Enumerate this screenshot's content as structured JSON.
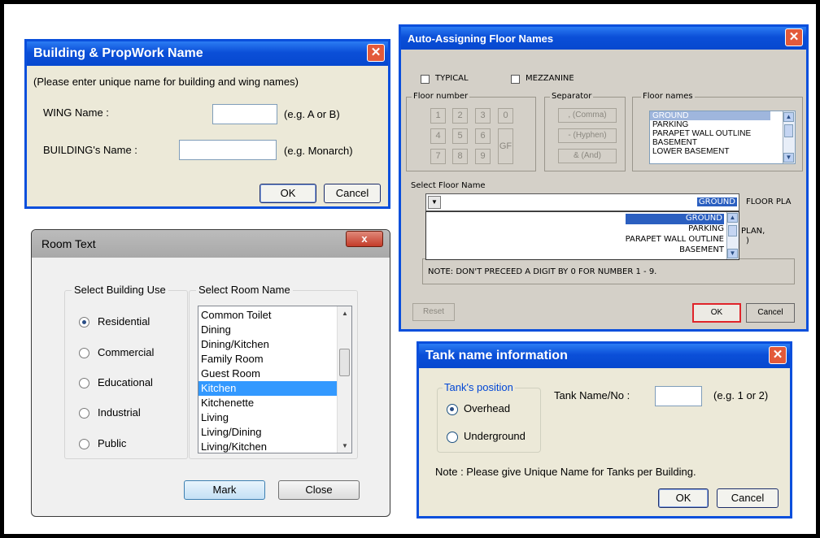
{
  "building_dialog": {
    "title": "Building & PropWork Name",
    "instruction": "(Please enter unique name for building and wing names)",
    "wing_label": "WING Name :",
    "wing_value": "",
    "wing_hint": "(e.g. A or B)",
    "building_label": "BUILDING's Name :",
    "building_value": "",
    "building_hint": "(e.g. Monarch)",
    "ok": "OK",
    "cancel": "Cancel",
    "close": "✕"
  },
  "room_dialog": {
    "title": "Room Text",
    "close": "x",
    "use_group": "Select Building Use",
    "uses": [
      {
        "label": "Residential",
        "selected": true
      },
      {
        "label": "Commercial",
        "selected": false
      },
      {
        "label": "Educational",
        "selected": false
      },
      {
        "label": "Industrial",
        "selected": false
      },
      {
        "label": "Public",
        "selected": false
      }
    ],
    "room_group": "Select Room Name",
    "rooms": [
      "Common Toilet",
      "Dining",
      "Dining/Kitchen",
      "Family Room",
      "Guest Room",
      "Kitchen",
      "Kitchenette",
      "Living",
      "Living/Dining",
      "Living/Kitchen"
    ],
    "selected_room": "Kitchen",
    "mark": "Mark",
    "close_btn": "Close"
  },
  "floor_dialog": {
    "title": "Auto-Assigning Floor Names",
    "typical": "TYPICAL",
    "mezzanine": "MEZZANINE",
    "floor_number_group": "Floor number",
    "numbers": [
      "1",
      "2",
      "3",
      "0",
      "4",
      "5",
      "6",
      "GF",
      "7",
      "8",
      "9"
    ],
    "separator_group": "Separator",
    "separators": [
      ", (Comma)",
      "- (Hyphen)",
      "& (And)"
    ],
    "floor_names_group": "Floor names",
    "floor_names": [
      "GROUND",
      "PARKING",
      "PARAPET WALL OUTLINE",
      "BASEMENT",
      "LOWER BASEMENT"
    ],
    "select_label": "Select Floor Name",
    "select_value": "GROUND",
    "trail_text": "FLOOR PLA",
    "dropdown_items": [
      "GROUND",
      "PARKING",
      "PARAPET WALL OUTLINE",
      "BASEMENT"
    ],
    "behind_text_1": "PLAN,",
    "behind_text_2": ")",
    "note": "NOTE: DON'T PRECEED A DIGIT BY 0 FOR NUMBER 1 - 9.",
    "reset": "Reset",
    "ok": "OK",
    "cancel": "Cancel",
    "close": "✕"
  },
  "tank_dialog": {
    "title": "Tank name information",
    "position_group": "Tank's position",
    "options": [
      {
        "label": "Overhead",
        "selected": true
      },
      {
        "label": "Underground",
        "selected": false
      }
    ],
    "name_label": "Tank Name/No :",
    "name_value": "",
    "hint": "(e.g. 1 or 2)",
    "note": "Note : Please give Unique Name for Tanks per Building.",
    "ok": "OK",
    "cancel": "Cancel",
    "close": "✕"
  },
  "colors": {
    "xp_title": "#0b4fd8",
    "xp_body": "#ece9d8",
    "selection": "#3399ff",
    "close_red": "#e35a3a"
  }
}
